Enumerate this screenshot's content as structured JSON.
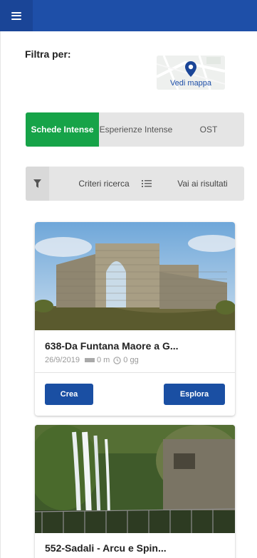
{
  "header": {
    "menu_icon": "hamburger-icon",
    "color": "#1e4fa8"
  },
  "filters": {
    "label": "Filtra per:",
    "map_link": "Vedi mappa",
    "map_icon": "map-pin-icon"
  },
  "tabs": [
    {
      "label": "Schede Intense",
      "active": true
    },
    {
      "label": "Esperienze Intense",
      "active": false
    },
    {
      "label": "OST",
      "active": false
    }
  ],
  "actions": {
    "filter_icon": "funnel-icon",
    "criteria": "Criteri ricerca",
    "list_icon": "list-icon",
    "results": "Vai ai risultati"
  },
  "cards": [
    {
      "title": "638-Da Funtana Maore a G...",
      "date": "26/9/2019",
      "distance": "0 m",
      "duration": "0 gg",
      "create_label": "Crea",
      "explore_label": "Esplora"
    },
    {
      "title": "552-Sadali - Arcu e Spin..."
    }
  ],
  "colors": {
    "accent_green": "#16a348",
    "primary_blue": "#1a4fa3"
  }
}
